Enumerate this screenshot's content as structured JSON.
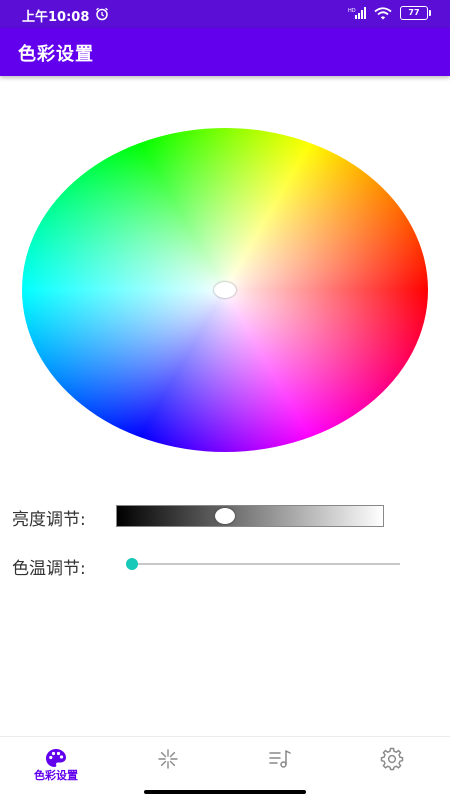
{
  "status_bar": {
    "time": "上午10:08",
    "battery": "77"
  },
  "app_bar": {
    "title": "色彩设置"
  },
  "color_wheel": {
    "selected_color": "#ffffff"
  },
  "brightness": {
    "label": "亮度调节:",
    "value": 0.4
  },
  "color_temperature": {
    "label": "色温调节:",
    "value": 0.0
  },
  "bottom_nav": {
    "items": [
      {
        "label": "色彩设置",
        "icon": "palette-icon",
        "active": true
      },
      {
        "icon": "burst-icon",
        "active": false
      },
      {
        "icon": "music-list-icon",
        "active": false
      },
      {
        "icon": "gear-icon",
        "active": false
      }
    ]
  },
  "colors": {
    "primary": "#6200ee",
    "status_bar": "#5b0fd6",
    "accent": "#18c8b8"
  }
}
